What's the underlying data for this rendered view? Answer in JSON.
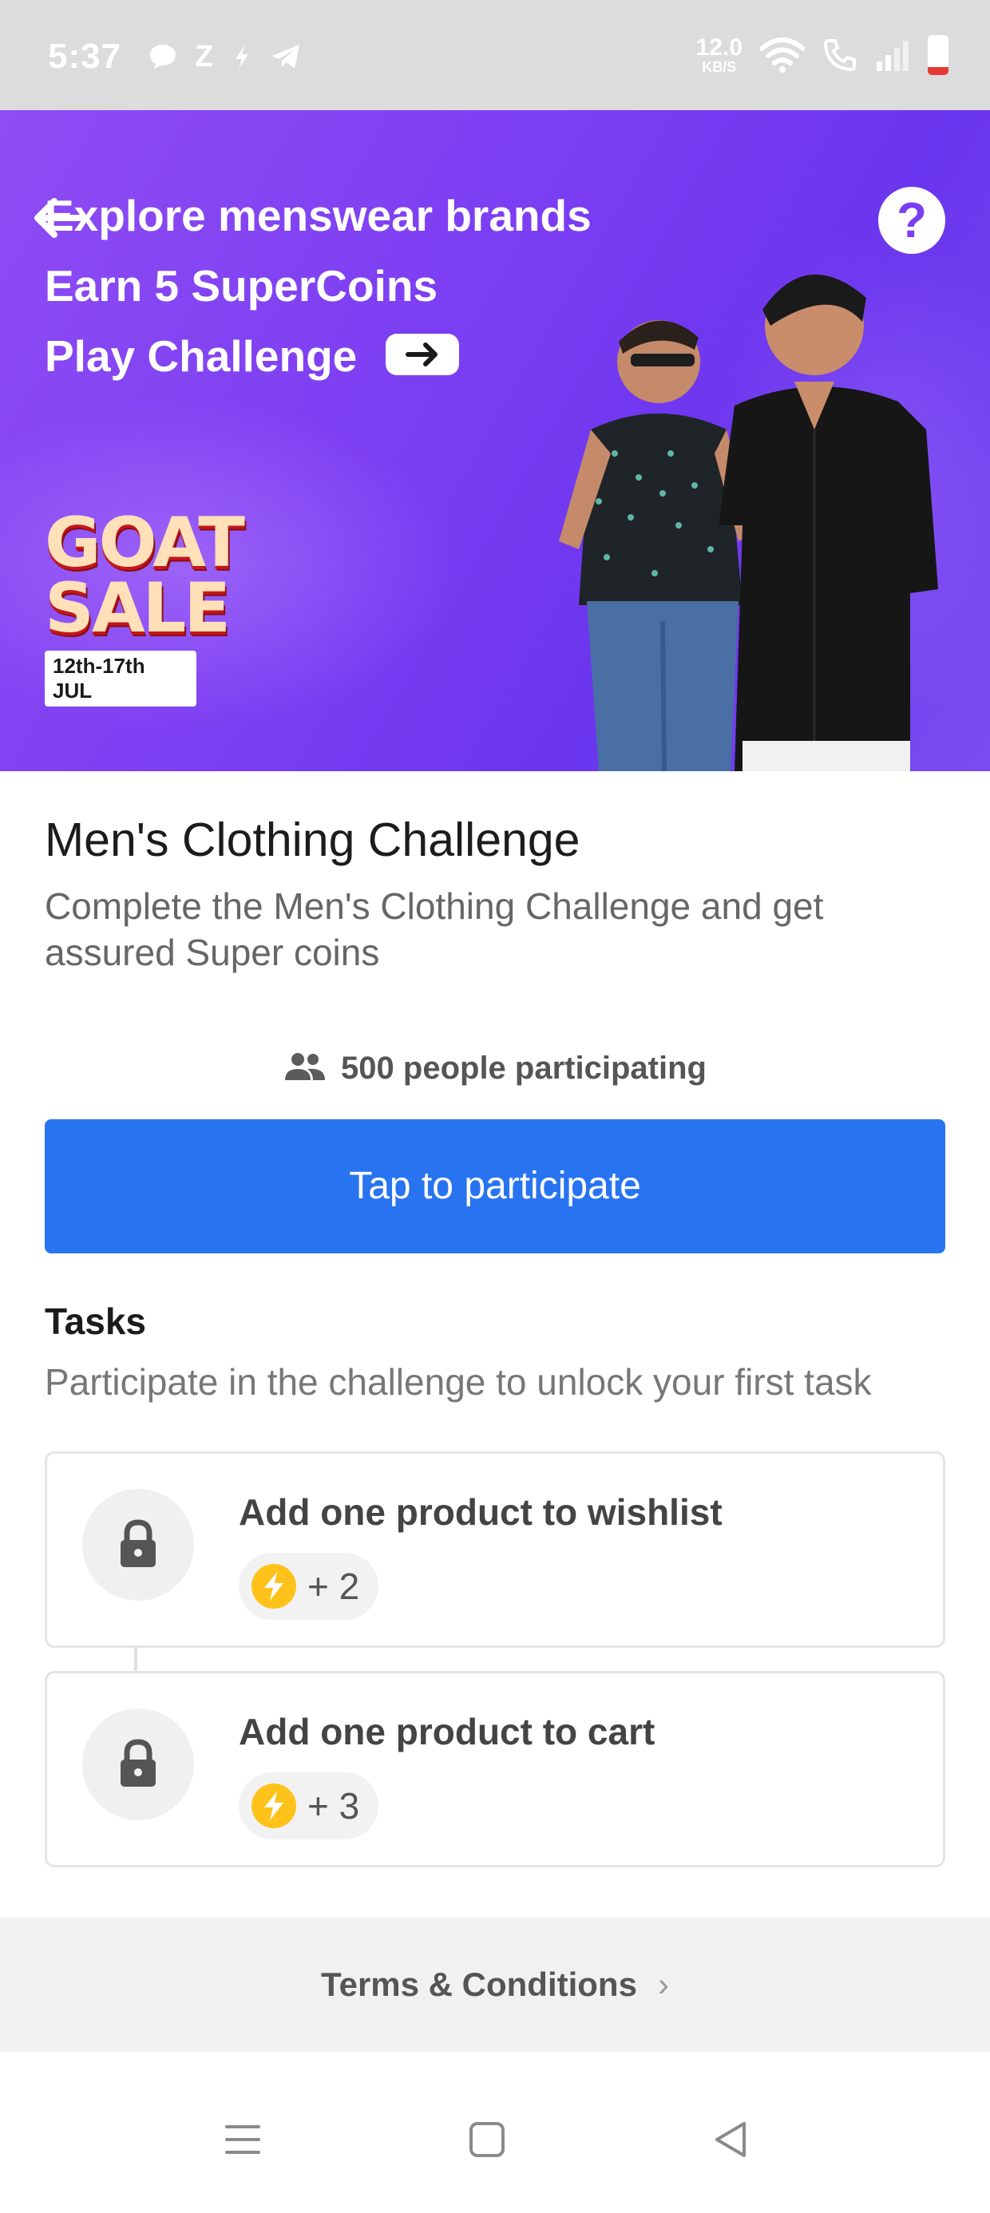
{
  "status_bar": {
    "time": "5:37",
    "net_speed_value": "12.0",
    "net_speed_unit": "KB/S",
    "left_icons": [
      "chat-bubble-icon",
      "z-app-icon",
      "flash-icon",
      "telegram-icon"
    ],
    "right_icons": [
      "wifi-icon",
      "wifi-calling-icon",
      "signal-icon",
      "battery-icon"
    ]
  },
  "banner": {
    "line1": "Explore menswear brands",
    "line2": "Earn 5 SuperCoins",
    "line3": "Play Challenge",
    "sale_word1": "GOAT",
    "sale_word2": "SALE",
    "sale_dates": "12th-17th JUL",
    "help_label": "?",
    "background_color": "#7a3df2"
  },
  "challenge": {
    "title": "Men's Clothing Challenge",
    "description": "Complete the Men's Clothing Challenge and get assured Super coins",
    "participants_text": "500 people participating",
    "participate_button": "Tap to participate"
  },
  "tasks": {
    "heading": "Tasks",
    "subheading": "Participate in the challenge to unlock your first task",
    "items": [
      {
        "label": "Add one product to wishlist",
        "reward": "+ 2",
        "locked": true
      },
      {
        "label": "Add one product to cart",
        "reward": "+ 3",
        "locked": true
      }
    ]
  },
  "footer": {
    "terms_label": "Terms & Conditions",
    "terms_chevron": "›"
  },
  "colors": {
    "accent": "#2874f0",
    "coin": "#ffc21a"
  }
}
